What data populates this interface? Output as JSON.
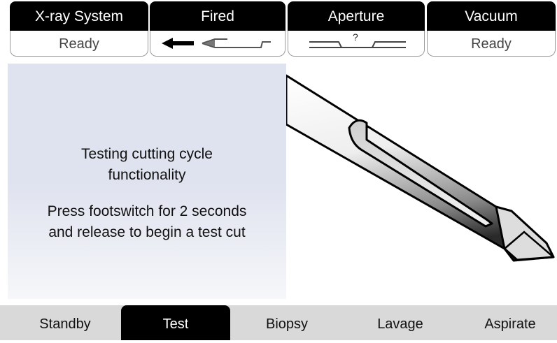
{
  "status": {
    "xray": {
      "title": "X-ray System",
      "value": "Ready"
    },
    "fired": {
      "title": "Fired",
      "value_icon": "needle-fired-position-icon"
    },
    "aperture": {
      "title": "Aperture",
      "value": "?"
    },
    "vacuum": {
      "title": "Vacuum",
      "value": "Ready"
    }
  },
  "instructions": {
    "line1": "Testing cutting cycle",
    "line2": "functionality",
    "line3": "Press footswitch for 2 seconds",
    "line4": "and release to begin a test cut"
  },
  "illustration": {
    "icon": "biopsy-needle-illustration"
  },
  "tabs": [
    {
      "label": "Standby",
      "active": false
    },
    {
      "label": "Test",
      "active": true
    },
    {
      "label": "Biopsy",
      "active": false
    },
    {
      "label": "Lavage",
      "active": false
    },
    {
      "label": "Aspirate",
      "active": false
    }
  ],
  "colors": {
    "header_bg": "#000000",
    "tab_bar_bg": "#d9d9d9",
    "panel_gradient_top": "#dfe3ef"
  }
}
